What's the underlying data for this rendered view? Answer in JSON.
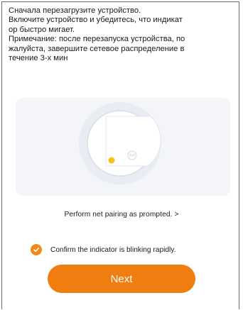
{
  "instructions": {
    "text": "Сначала перезагрузите устройство.\nВключите устройство и убедитесь, что индикат\nор быстро мигает.\nПримечание: после перезапуска устройства, по\nжалуйста, завершите сетевое распределение в\n течение 3-х мин"
  },
  "illustration": {
    "device_icon": "device-illustration-icon",
    "indicator_icon": "indicator-led-icon",
    "indicator_color": "#f2c318",
    "logo_icon": "device-logo-icon"
  },
  "pairing_link": {
    "label": "Perform net pairing as prompted. >"
  },
  "confirm": {
    "label": "Confirm the indicator is blinking rapidly.",
    "checked": true,
    "check_color": "#f08a1a"
  },
  "next_button": {
    "label": "Next",
    "color": "#f07d10"
  }
}
